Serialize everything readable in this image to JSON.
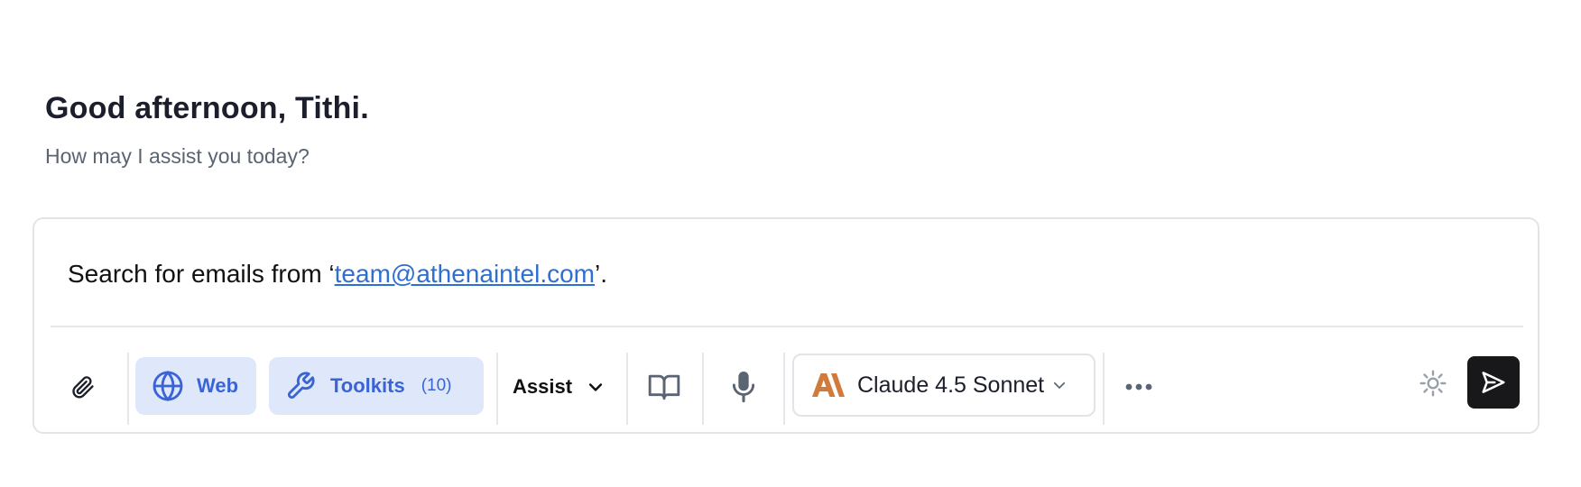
{
  "header": {
    "greeting": "Good afternoon, Tithi.",
    "subtitle": "How may I assist you today?"
  },
  "composer": {
    "prompt_prefix": "Search for emails from ‘",
    "prompt_link": "team@athenaintel.com",
    "prompt_suffix": "’."
  },
  "toolbar": {
    "attach_icon": "paperclip-icon",
    "web_label": "Web",
    "web_icon": "globe-icon",
    "toolkits_label": "Toolkits",
    "toolkits_count": "(10)",
    "toolkits_icon": "wrench-icon",
    "mode_label": "Assist",
    "library_icon": "book-icon",
    "mic_icon": "microphone-icon",
    "model_label": "Claude 4.5 Sonnet",
    "model_icon": "anthropic-logo-icon",
    "more_icon": "more-dots-icon",
    "settings_icon": "gear-icon",
    "send_icon": "send-icon"
  },
  "colors": {
    "accent_blue": "#3a63d6",
    "pill_bg": "#dfe8fb",
    "link": "#2f6fd1",
    "anthropic_orange": "#d27a3a",
    "send_bg": "#18181b"
  }
}
